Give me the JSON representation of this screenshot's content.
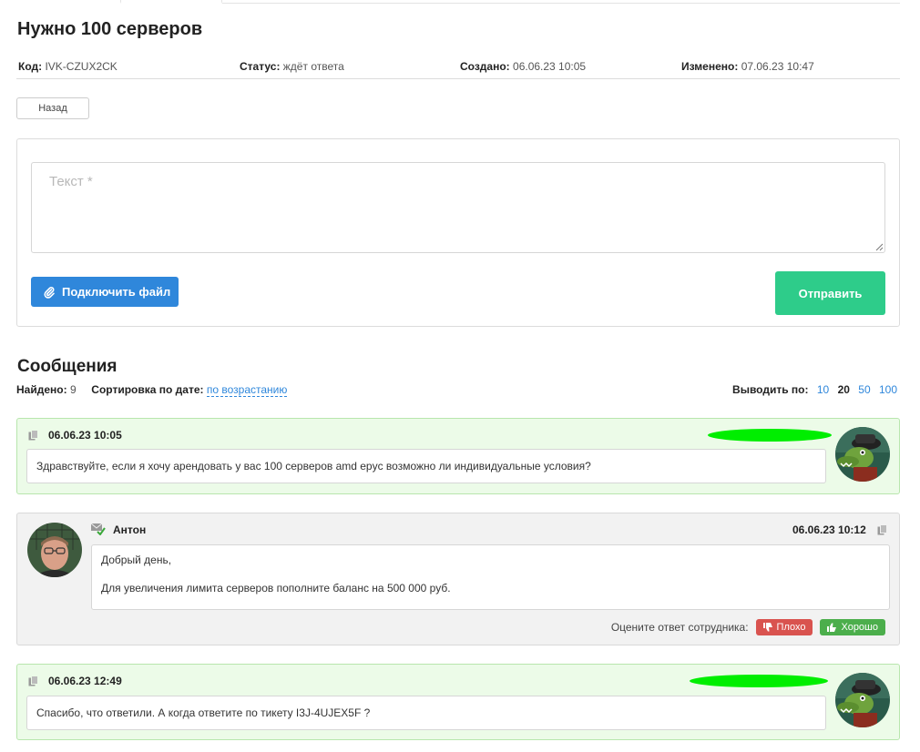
{
  "ticket": {
    "title": "Нужно 100 серверов",
    "code_label": "Код:",
    "code": "IVK-CZUX2CK",
    "status_label": "Статус:",
    "status": "ждёт ответа",
    "created_label": "Создано:",
    "created": "06.06.23 10:05",
    "modified_label": "Изменено:",
    "modified": "07.06.23 10:47"
  },
  "back_button": "Назад",
  "reply": {
    "placeholder": "Текст *",
    "attach_label": "Подключить файл",
    "send_label": "Отправить"
  },
  "messages_section": {
    "title": "Сообщения",
    "found_label": "Найдено:",
    "found_count": "9",
    "sort_label": "Сортировка по дате:",
    "sort_value": "по возрастанию",
    "perpage_label": "Выводить по:",
    "perpage_options": [
      "10",
      "20",
      "50",
      "100"
    ],
    "perpage_selected": "20"
  },
  "messages": [
    {
      "type": "client",
      "date": "06.06.23 10:05",
      "text": "Здравствуйте, если я хочу арендовать у вас 100 серверов amd epyc возможно ли индивидуальные условия?"
    },
    {
      "type": "staff",
      "author": "Антон",
      "date": "06.06.23 10:12",
      "lines": [
        "Добрый день,",
        "Для увеличения лимита серверов пополните баланс на 500 000 руб."
      ],
      "rate_label": "Оцените ответ сотрудника:",
      "bad_label": "Плохо",
      "good_label": "Хорошо"
    },
    {
      "type": "client",
      "date": "06.06.23 12:49",
      "text": "Спасибо, что ответили. А когда ответите по тикету I3J-4UJEX5F ?"
    }
  ],
  "colors": {
    "accent_blue": "#2f87db",
    "send_green": "#2ecc8a",
    "client_bg": "#ecfbe8",
    "staff_bg": "#f2f2f2",
    "bad_red": "#d9534f",
    "good_green": "#4cae4c"
  },
  "icons": [
    "paperclip-icon",
    "copy-icon",
    "mail-check-icon",
    "thumbs-down-icon",
    "thumbs-up-icon"
  ]
}
